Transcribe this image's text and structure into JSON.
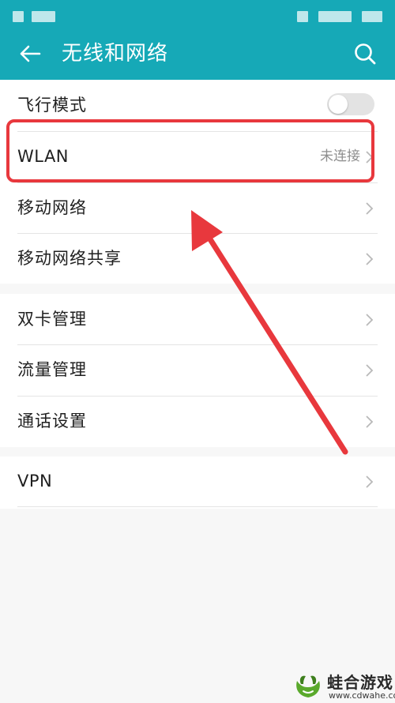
{
  "header": {
    "title": "无线和网络",
    "background_color": "#16a9b7",
    "back_icon": "arrow-left-icon",
    "search_icon": "search-icon"
  },
  "status_bar": {
    "icons": [
      "signal-block-icon",
      "battery-block-icon"
    ]
  },
  "settings": {
    "airplane_mode": {
      "label": "飞行模式",
      "toggle_on": false
    },
    "wlan": {
      "label": "WLAN",
      "value": "未连接"
    },
    "mobile_network": {
      "label": "移动网络"
    },
    "hotspot": {
      "label": "移动网络共享"
    },
    "dual_sim": {
      "label": "双卡管理"
    },
    "data_usage": {
      "label": "流量管理"
    },
    "call_settings": {
      "label": "通话设置"
    },
    "vpn": {
      "label": "VPN"
    }
  },
  "annotation": {
    "highlight_color": "#e8383d",
    "arrow_color": "#e8383d"
  },
  "watermark": {
    "name": "蛙合游戏",
    "url": "www.cdwahe.com"
  }
}
